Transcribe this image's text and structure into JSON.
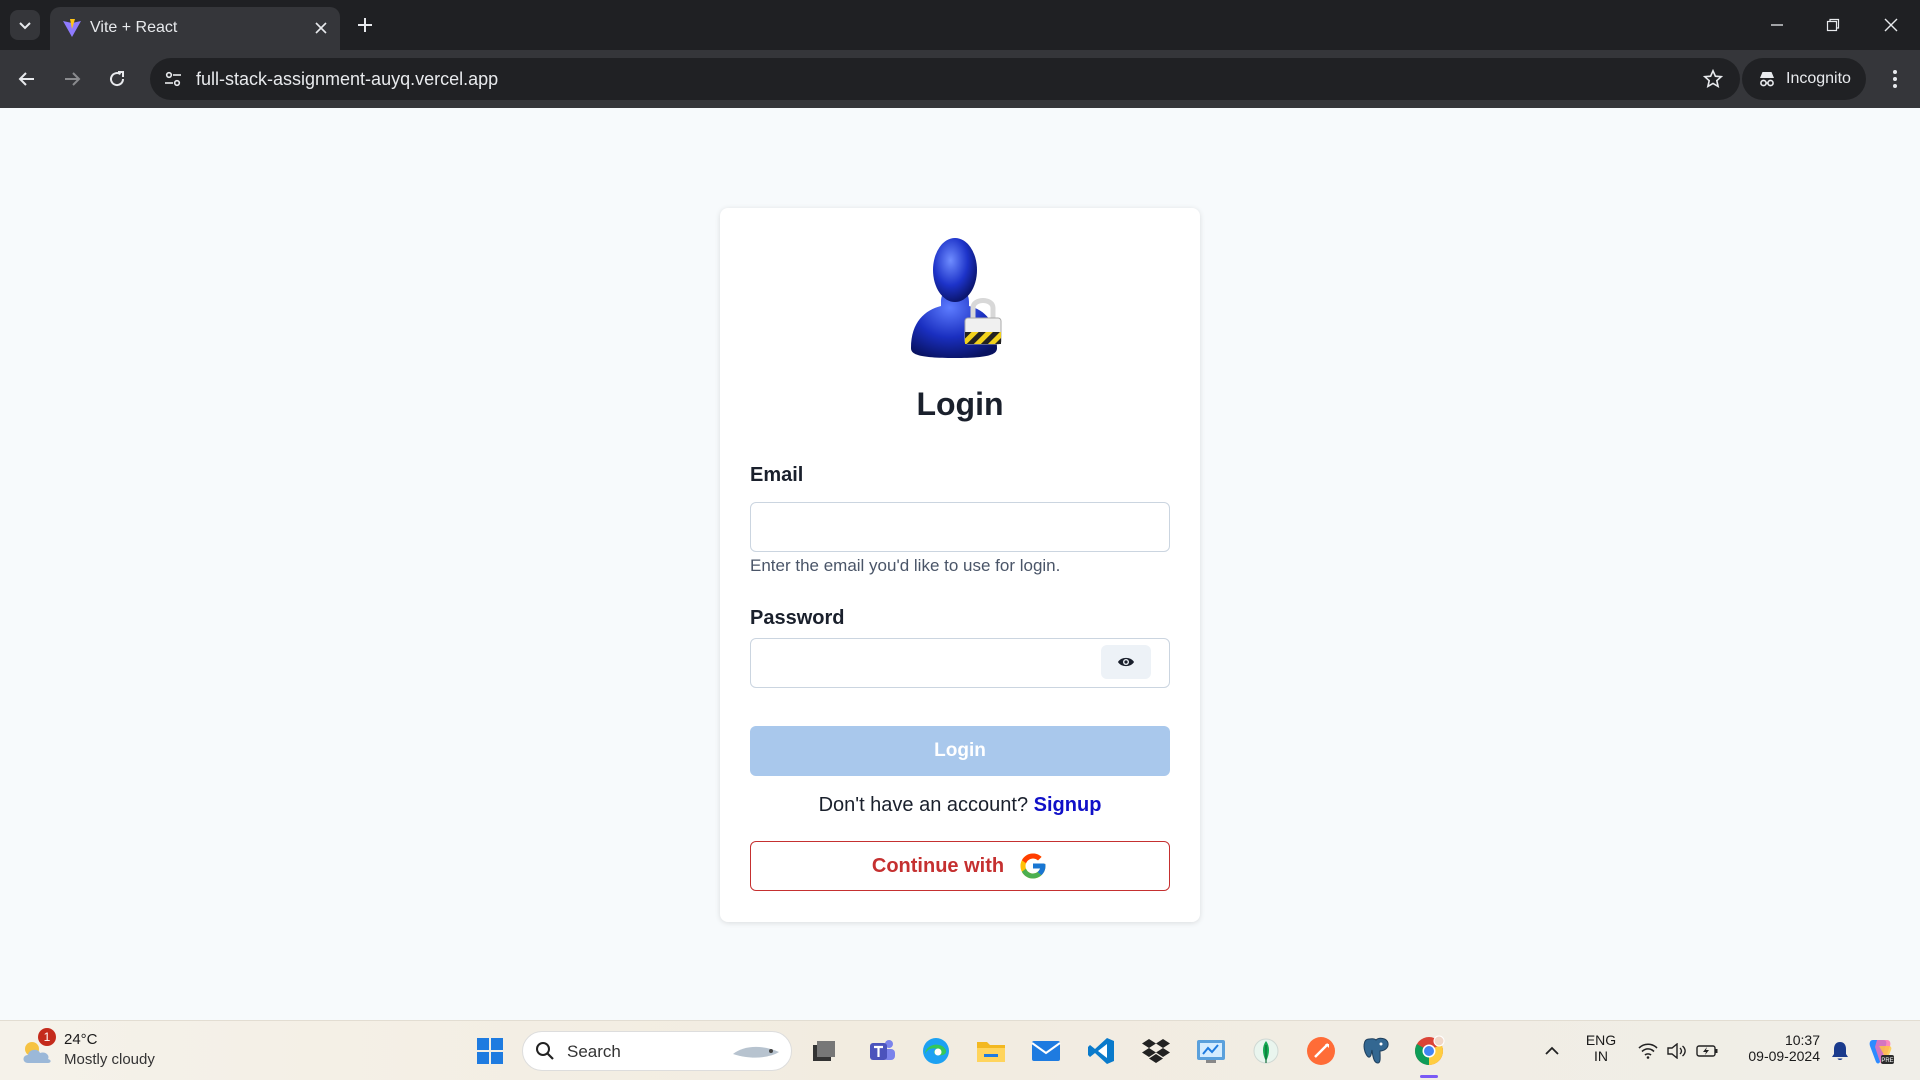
{
  "browser": {
    "tab_title": "Vite + React",
    "url": "full-stack-assignment-auyq.vercel.app",
    "incognito_label": "Incognito"
  },
  "login": {
    "title": "Login",
    "email_label": "Email",
    "email_value": "",
    "email_helper": "Enter the email you'd like to use for login.",
    "password_label": "Password",
    "password_value": "",
    "login_button": "Login",
    "signup_prompt": "Don't have an account?",
    "signup_link": "Signup",
    "google_button": "Continue with"
  },
  "taskbar": {
    "weather_temp": "24°C",
    "weather_condition": "Mostly cloudy",
    "weather_badge": "1",
    "search_placeholder": "Search",
    "language_line1": "ENG",
    "language_line2": "IN",
    "time": "10:37",
    "date": "09-09-2024",
    "pinned_apps": [
      "windows-start-icon",
      "task-view-icon",
      "teams-icon",
      "edge-icon",
      "file-explorer-icon",
      "mail-icon",
      "vscode-icon",
      "dropbox-icon",
      "control-panel-icon",
      "mongodb-icon",
      "postman-icon",
      "postgresql-icon",
      "chrome-icon"
    ]
  },
  "colors": {
    "login_button_disabled": "#a9c8ec",
    "google_button_accent": "#c53030",
    "signup_link": "#1010c8",
    "page_background": "#f7fafc"
  }
}
